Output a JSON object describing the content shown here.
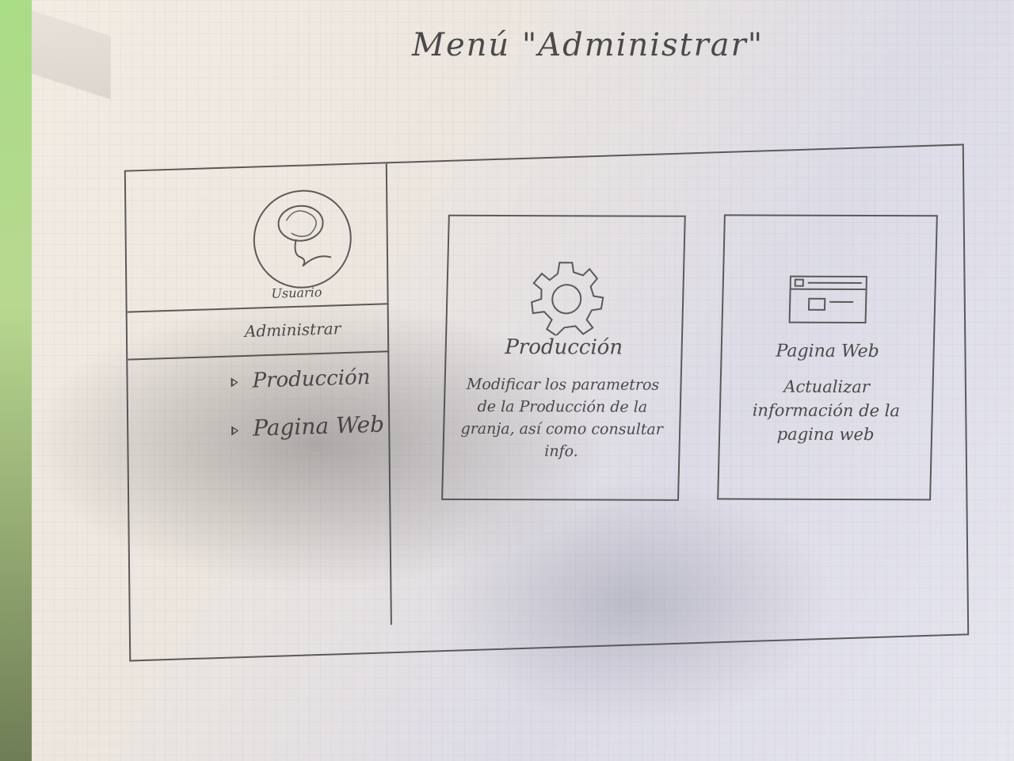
{
  "title": "Menú \"Administrar\"",
  "sidebar": {
    "user_label": "Usuario",
    "role_label": "Administrar",
    "nav": [
      {
        "label": "Producción",
        "icon": "triangle-right-icon"
      },
      {
        "label": "Pagina Web",
        "icon": "triangle-right-icon"
      }
    ]
  },
  "cards": [
    {
      "title": "Producción",
      "icon": "gear-icon",
      "description": "Modificar los parametros de la Producción de la granja, así como consultar info."
    },
    {
      "title": "Pagina Web",
      "icon": "browser-window-icon",
      "description": "Actualizar información de la pagina web"
    }
  ],
  "colors": {
    "ink": "#4a4a4a",
    "paper": "#ece6df",
    "background_green": "#a9dc86"
  }
}
